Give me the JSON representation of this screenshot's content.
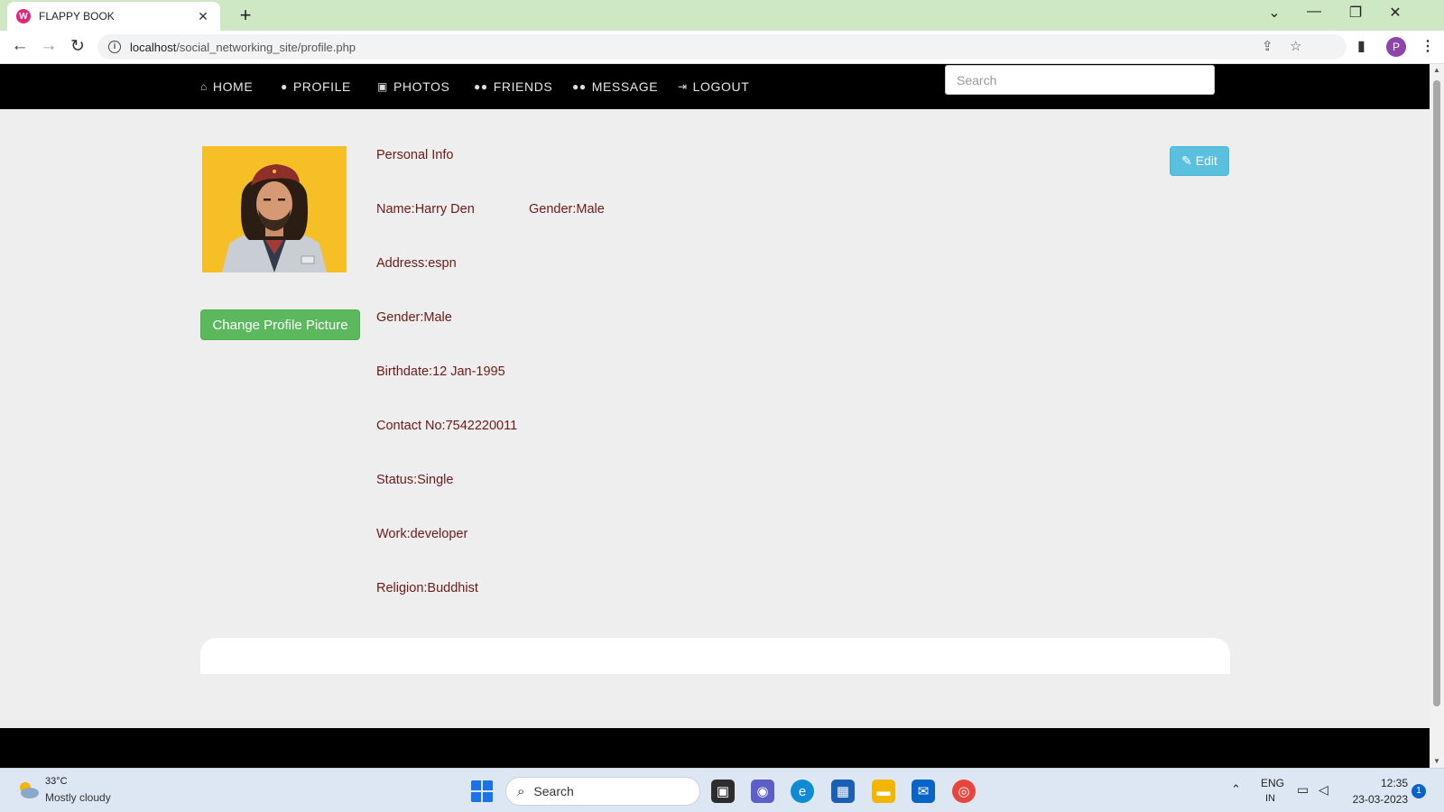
{
  "browser": {
    "tab_title": "FLAPPY BOOK",
    "tab_favicon": "W",
    "new_tab_symbol": "+",
    "close_symbol": "✕",
    "url_host": "localhost",
    "url_path": "/social_networking_site/profile.php",
    "profile_initial": "P"
  },
  "nav": {
    "items": [
      {
        "label": "HOME",
        "icon": "home-icon"
      },
      {
        "label": "PROFILE",
        "icon": "user-icon"
      },
      {
        "label": "PHOTOS",
        "icon": "image-icon"
      },
      {
        "label": "FRIENDS",
        "icon": "users-icon"
      },
      {
        "label": "MESSAGE",
        "icon": "users-icon"
      },
      {
        "label": "LOGOUT",
        "icon": "sign-out-icon"
      }
    ],
    "search_placeholder": "Search"
  },
  "profile": {
    "change_picture_label": "Change Profile Picture",
    "edit_label": "Edit",
    "section_title": "Personal Info",
    "name": "Name:Harry Den",
    "gender_inline": "Gender:Male",
    "address": "Address:espn",
    "gender": "Gender:Male",
    "birthdate": "Birthdate:12 Jan-1995",
    "contact": "Contact No:7542220011",
    "status": "Status:Single",
    "work": "Work:developer",
    "religion": "Religion:Buddhist"
  },
  "taskbar": {
    "weather_temp": "33°C",
    "weather_desc": "Mostly cloudy",
    "search_label": "Search",
    "lang_top": "ENG",
    "lang_bottom": "IN",
    "time": "12:35",
    "date": "23-03-2023",
    "notification_count": "1"
  },
  "colors": {
    "navbar": "#000000",
    "page_bg": "#eeeeee",
    "info_text": "#6b1a1a",
    "success_button": "#5cb85c",
    "info_button": "#5bc0de",
    "tab_strip": "#cfe8c4"
  }
}
